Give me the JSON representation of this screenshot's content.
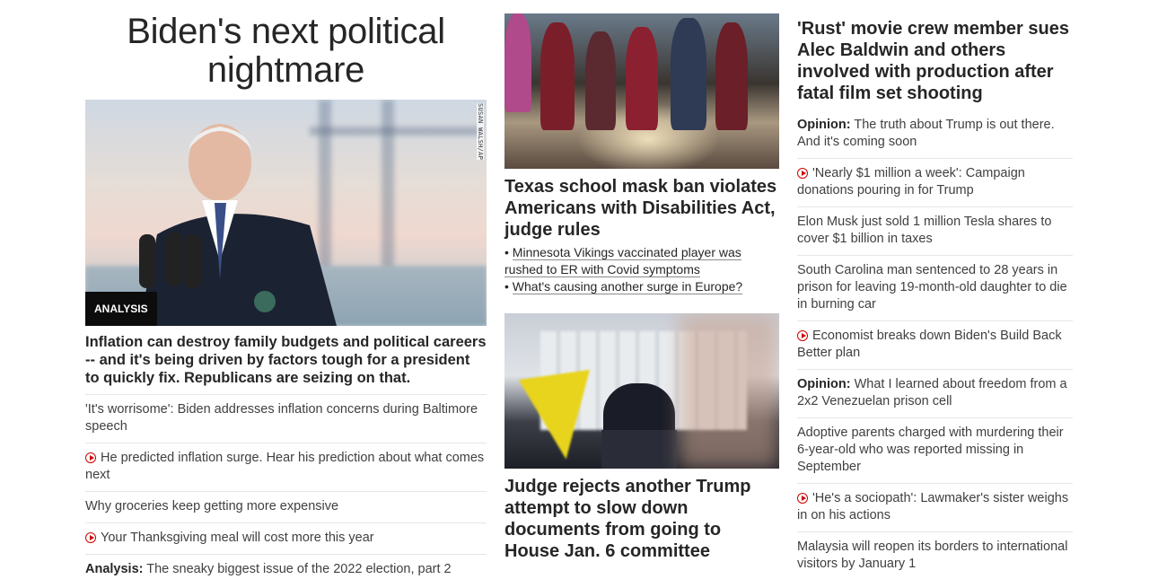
{
  "column1": {
    "headline": "Biden's next political nightmare",
    "image_credit": "SUSAN WALSH/AP",
    "badge": "ANALYSIS",
    "lead": "Inflation can destroy family budgets and political careers -- and it's being driven by factors tough for a president to quickly fix. Republicans are seizing on that.",
    "items": [
      {
        "label": "",
        "text": "'It's worrisome': Biden addresses inflation concerns during Baltimore speech",
        "video": false
      },
      {
        "label": "",
        "text": "He predicted inflation surge. Hear his prediction about what comes next",
        "video": true
      },
      {
        "label": "",
        "text": "Why groceries keep getting more expensive",
        "video": false
      },
      {
        "label": "",
        "text": "Your Thanksgiving meal will cost more this year",
        "video": true
      },
      {
        "label": "Analysis:",
        "text": " The sneaky biggest issue of the 2022 election, part 2",
        "video": false
      }
    ]
  },
  "column2": {
    "story1": {
      "headline": "Texas school mask ban violates Americans with Disabilities Act, judge rules",
      "bullets": [
        "Minnesota Vikings vaccinated player was rushed to ER with Covid symptoms",
        "What's causing another surge in Europe?"
      ]
    },
    "story2": {
      "headline": "Judge rejects another Trump attempt to slow down documents from going to House Jan. 6 committee"
    }
  },
  "column3": {
    "headline": "'Rust' movie crew member sues Alec Baldwin and others involved with production after fatal film set shooting",
    "items": [
      {
        "label": "Opinion:",
        "text": " The truth about Trump is out there. And it's coming soon",
        "video": false
      },
      {
        "label": "",
        "text": "'Nearly $1 million a week': Campaign donations pouring in for Trump",
        "video": true
      },
      {
        "label": "",
        "text": "Elon Musk just sold 1 million Tesla shares to cover $1 billion in taxes",
        "video": false
      },
      {
        "label": "",
        "text": "South Carolina man sentenced to 28 years in prison for leaving 19-month-old daughter to die in burning car",
        "video": false
      },
      {
        "label": "",
        "text": "Economist breaks down Biden's Build Back Better plan",
        "video": true
      },
      {
        "label": "Opinion:",
        "text": " What I learned about freedom from a 2x2 Venezuelan prison cell",
        "video": false
      },
      {
        "label": "",
        "text": "Adoptive parents charged with murdering their 6-year-old who was reported missing in September",
        "video": false
      },
      {
        "label": "",
        "text": "'He's a sociopath': Lawmaker's sister weighs in on his actions",
        "video": true
      },
      {
        "label": "",
        "text": "Malaysia will reopen its borders to international visitors by January 1",
        "video": false
      }
    ]
  },
  "colors": {
    "video_icon": "#cc0000",
    "badge_bg": "#0c0c0c",
    "divider": "#e6e6e6"
  }
}
